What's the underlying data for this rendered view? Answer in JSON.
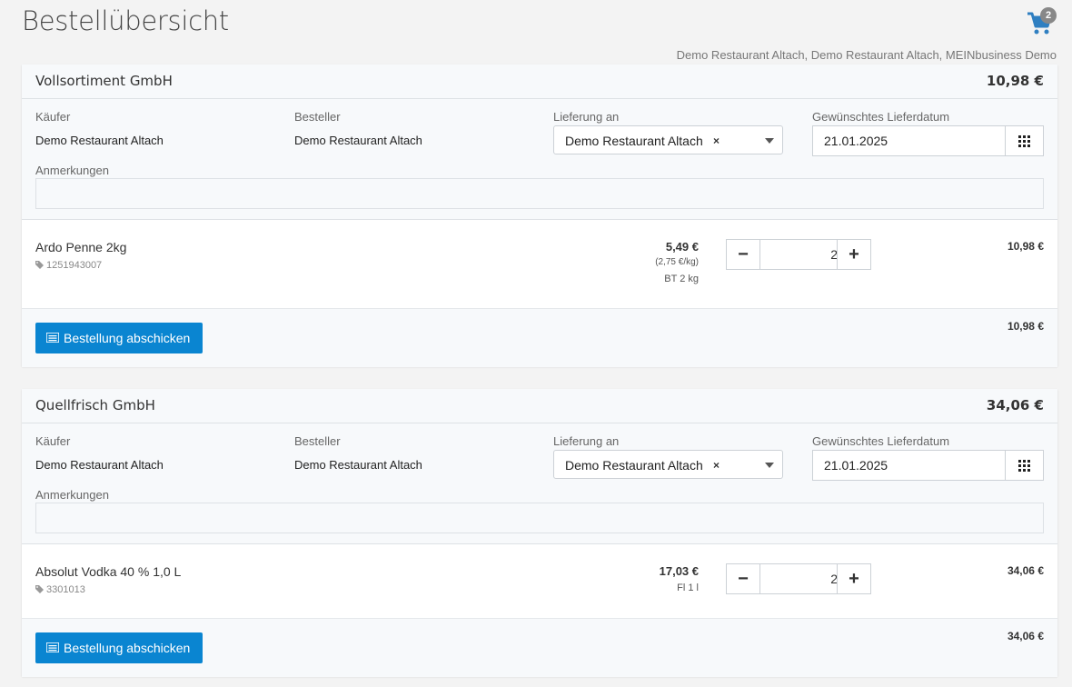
{
  "page": {
    "title": "Bestellübersicht",
    "context": "Demo Restaurant Altach, Demo Restaurant Altach, MEINbusiness Demo",
    "cart_count": "2",
    "cart_icon": "shopping-cart-icon"
  },
  "labels": {
    "buyer": "Käufer",
    "orderer": "Besteller",
    "delivery": "Lieferung an",
    "date": "Gewünschtes Lieferdatum",
    "remarks": "Anmerkungen",
    "submit": "Bestellung abschicken",
    "clear": "×"
  },
  "orders": [
    {
      "supplier": "Vollsortiment GmbH",
      "total": "10,98 €",
      "buyer": "Demo Restaurant Altach",
      "orderer": "Demo Restaurant Altach",
      "delivery": "Demo Restaurant Altach",
      "date": "21.01.2025",
      "remarks": "",
      "item": {
        "name": "Ardo Penne 2kg",
        "code": "1251943007",
        "price": "5,49 €",
        "unit_price": "(2,75 €/kg)",
        "pack": "BT 2 kg",
        "qty": "2",
        "line_total": "10,98 €"
      },
      "footer_total": "10,98 €"
    },
    {
      "supplier": "Quellfrisch GmbH",
      "total": "34,06 €",
      "buyer": "Demo Restaurant Altach",
      "orderer": "Demo Restaurant Altach",
      "delivery": "Demo Restaurant Altach",
      "date": "21.01.2025",
      "remarks": "",
      "item": {
        "name": "Absolut Vodka 40 % 1,0 L",
        "code": "3301013",
        "price": "17,03 €",
        "pack": "Fl 1 l",
        "qty": "2",
        "line_total": "34,06 €"
      },
      "footer_total": "34,06 €"
    }
  ],
  "colors": {
    "accent": "#0a85d1",
    "cart": "#2f7fc1",
    "badge": "#888888"
  }
}
